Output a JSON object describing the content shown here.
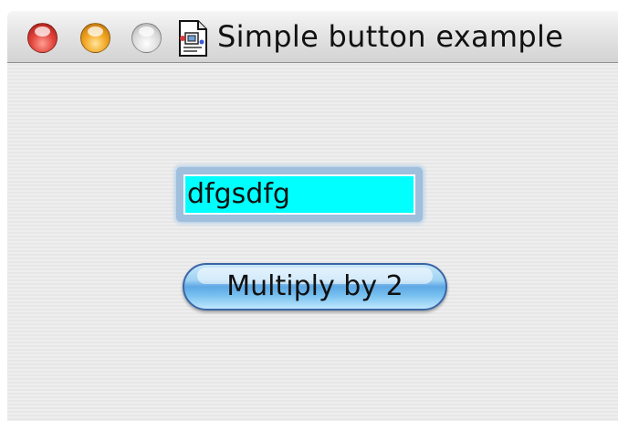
{
  "window": {
    "title": "Simple button example",
    "controls": {
      "close": "close-button",
      "minimize": "minimize-button",
      "zoom": "zoom-button"
    },
    "title_icon": "document-icon"
  },
  "form": {
    "text_field_value": "dfgsdfg",
    "text_field_bg": "#00ffff",
    "button_label": "Multiply by 2"
  }
}
